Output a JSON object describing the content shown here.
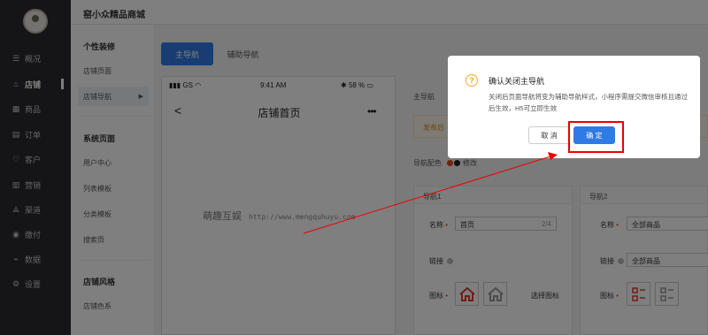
{
  "sidebar": {
    "items": [
      {
        "icon": "overview-icon",
        "glyph": "☰",
        "label": "概况"
      },
      {
        "icon": "shop-icon",
        "glyph": "⌂",
        "label": "店铺"
      },
      {
        "icon": "product-icon",
        "glyph": "▦",
        "label": "商品"
      },
      {
        "icon": "order-icon",
        "glyph": "▤",
        "label": "订单"
      },
      {
        "icon": "customer-icon",
        "glyph": "♡",
        "label": "客户"
      },
      {
        "icon": "marketing-icon",
        "glyph": "▥",
        "label": "营销"
      },
      {
        "icon": "channel-icon",
        "glyph": "⟁",
        "label": "渠道"
      },
      {
        "icon": "finance-icon",
        "glyph": "◉",
        "label": "缴付"
      },
      {
        "icon": "data-icon",
        "glyph": "⌁",
        "label": "数据"
      },
      {
        "icon": "settings-icon",
        "glyph": "⚙",
        "label": "设置"
      }
    ]
  },
  "header": {
    "shop_name": "窑小众精品商城"
  },
  "subnav": {
    "group1": "个性装修",
    "shop_page": "店铺页面",
    "shop_nav": "店铺导航",
    "group2": "系统页面",
    "user_center": "用户中心",
    "list_template": "列表模板",
    "category_template": "分类模板",
    "search_page": "搜索页",
    "group3": "店铺风格",
    "shop_color": "店铺色系"
  },
  "tabs": {
    "main": "主导航",
    "aux": "辅助导航"
  },
  "phone": {
    "carrier": "GS",
    "time": "9:41 AM",
    "battery": "58 %",
    "title": "店铺首页"
  },
  "watermark": {
    "text": "萌趣互娱",
    "url": "http://www.mengquhuyu.com"
  },
  "panel": {
    "label": "主导航",
    "notice": "发布后",
    "color_label": "导航配色",
    "color_edit": "修改",
    "nav1": {
      "header": "导航1",
      "name_label": "名称",
      "name_value": "首页",
      "name_count": "2/4",
      "link_label": "链接",
      "icon_label": "图标",
      "choose_icon": "选择图标"
    },
    "nav2": {
      "header": "导航2",
      "name_label": "名称",
      "name_value": "全部商品",
      "link_label": "链接",
      "link_value": "全部商品",
      "icon_label": "图标"
    }
  },
  "modal": {
    "title": "确认关闭主导航",
    "body": "关闭后页面导航将变为辅助导航样式，小程序需提交微信审核且通过后生效，H5可立即生效",
    "cancel": "取 消",
    "confirm": "确 定"
  },
  "colors": {
    "primary": "#2f7be6",
    "warning": "#f5a623",
    "annotation": "#ee0000",
    "sidebar_bg": "#2a2b30"
  }
}
